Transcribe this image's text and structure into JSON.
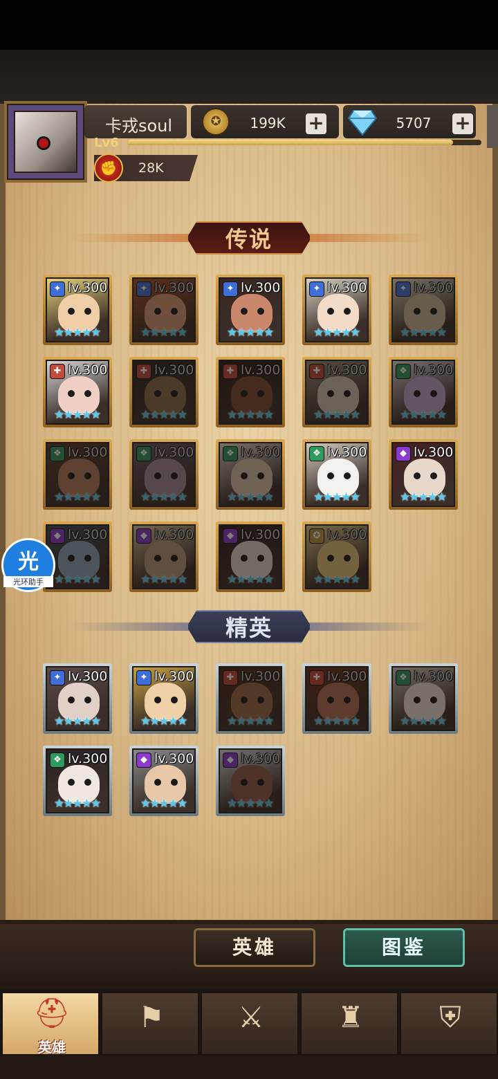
{
  "player": {
    "name": "卡戎soul",
    "level": "Lv6",
    "xp_fraction": 0.92,
    "coins": "199K",
    "gems": "5707",
    "power": "28K",
    "plus_symbol": "+"
  },
  "sections": {
    "legend_title": "传说",
    "elite_title": "精英"
  },
  "legend_heroes": [
    {
      "level": "lv.300",
      "stars": "★★★★★",
      "owned": true,
      "class": "blue",
      "skin": "#f0cfa8",
      "hair": "#e8d27a"
    },
    {
      "level": "lv.300",
      "stars": "★★★★★",
      "owned": false,
      "class": "blue",
      "skin": "#d49a7a",
      "hair": "#b2532c"
    },
    {
      "level": "lv.300",
      "stars": "★★★★★",
      "owned": true,
      "class": "blue",
      "skin": "#c9876b",
      "hair": "#3a2620"
    },
    {
      "level": "lv.300",
      "stars": "★★★★★",
      "owned": true,
      "class": "blue",
      "skin": "#f2dcc8",
      "hair": "#d8d0c0"
    },
    {
      "level": "lv.300",
      "stars": "★★★★★",
      "owned": false,
      "class": "blue",
      "skin": "#c7b59b",
      "hair": "#e7dfc7"
    },
    {
      "level": "lv.300",
      "stars": "★★★★★",
      "owned": true,
      "class": "red",
      "skin": "#f0d0c4",
      "hair": "#d6d6d6"
    },
    {
      "level": "lv.300",
      "stars": "★★★★★",
      "owned": false,
      "class": "red",
      "skin": "#8a6a4a",
      "hair": "#2a2420"
    },
    {
      "level": "lv.300",
      "stars": "★★★★★",
      "owned": false,
      "class": "red",
      "skin": "#7a4a34",
      "hair": "#2a1a14"
    },
    {
      "level": "lv.300",
      "stars": "★★★★★",
      "owned": false,
      "class": "red",
      "skin": "#cfc6b2",
      "hair": "#9a9080"
    },
    {
      "level": "lv.300",
      "stars": "★★★★★",
      "owned": false,
      "class": "green",
      "skin": "#b7a7c8",
      "hair": "#e1dde8"
    },
    {
      "level": "lv.300",
      "stars": "★★★★★",
      "owned": false,
      "class": "green",
      "skin": "#b07a5e",
      "hair": "#5a3a2a"
    },
    {
      "level": "lv.300",
      "stars": "★★★★★",
      "owned": false,
      "class": "green",
      "skin": "#a08a9a",
      "hair": "#6a5a6a"
    },
    {
      "level": "lv.300",
      "stars": "★★★★★",
      "owned": false,
      "class": "green",
      "skin": "#d8c2a8",
      "hair": "#e8e0d4"
    },
    {
      "level": "lv.300",
      "stars": "★★★★★",
      "owned": true,
      "class": "green",
      "skin": "#f4f2ee",
      "hair": "#d0c8bc"
    },
    {
      "level": "lv.300",
      "stars": "★★★★★",
      "owned": true,
      "class": "purple",
      "skin": "#e8d8cc",
      "hair": "#4a1e22"
    },
    {
      "level": "lv.300",
      "stars": "★★★★★",
      "owned": false,
      "class": "purple",
      "skin": "#8aa2b8",
      "hair": "#3a4a5a"
    },
    {
      "level": "lv.300",
      "stars": "★★★★★",
      "owned": false,
      "class": "purple",
      "skin": "#b29a82",
      "hair": "#d8c8a0"
    },
    {
      "level": "lv.300",
      "stars": "★★★★★",
      "owned": false,
      "class": "purple",
      "skin": "#e0d8d0",
      "hair": "#2a2020"
    },
    {
      "level": "lv.300",
      "stars": "★★★★★",
      "owned": false,
      "class": "gold",
      "skin": "#e2c27a",
      "hair": "#e8d28a"
    }
  ],
  "elite_heroes": [
    {
      "level": "lv.300",
      "stars": "★★★★★",
      "owned": true,
      "class": "blue",
      "skin": "#e0d0c8",
      "hair": "#5a4a48"
    },
    {
      "level": "lv.300",
      "stars": "★★★★★",
      "owned": true,
      "class": "blue",
      "skin": "#f0d0a8",
      "hair": "#c8a040"
    },
    {
      "level": "lv.300",
      "stars": "★★★★★",
      "owned": false,
      "class": "red",
      "skin": "#9a6a4a",
      "hair": "#4a2a1a"
    },
    {
      "level": "lv.300",
      "stars": "★★★★★",
      "owned": false,
      "class": "red",
      "skin": "#b07058",
      "hair": "#6a3020"
    },
    {
      "level": "lv.300",
      "stars": "★★★★★",
      "owned": false,
      "class": "green",
      "skin": "#eae2da",
      "hair": "#d8d0c8"
    },
    {
      "level": "lv.300",
      "stars": "★★★★★",
      "owned": true,
      "class": "green",
      "skin": "#f0e8e0",
      "hair": "#2a2424"
    },
    {
      "level": "lv.300",
      "stars": "★★★★★",
      "owned": true,
      "class": "purple",
      "skin": "#e8c8a8",
      "hair": "#8a8a8a"
    },
    {
      "level": "lv.300",
      "stars": "★★★★★",
      "owned": false,
      "class": "purple",
      "skin": "#8a5a4a",
      "hair": "#e0e0e0"
    }
  ],
  "assist": {
    "glyph": "光",
    "label": "光环助手"
  },
  "buttons": {
    "heroes": "英雄",
    "codex": "图鉴"
  },
  "nav": [
    {
      "label": "英雄",
      "icon": "helmet-icon",
      "glyph": "⛑",
      "active": true
    },
    {
      "label": "",
      "icon": "flag-icon",
      "glyph": "⚑",
      "active": false
    },
    {
      "label": "",
      "icon": "swords-icon",
      "glyph": "⚔",
      "active": false
    },
    {
      "label": "",
      "icon": "castle-icon",
      "glyph": "♜",
      "active": false
    },
    {
      "label": "",
      "icon": "shield-icon",
      "glyph": "⛨",
      "active": false
    }
  ],
  "colors": {
    "class_blue": "#3f6fd6",
    "class_red": "#c24a3a",
    "class_green": "#2d9a5e",
    "class_purple": "#8b3ad0",
    "class_gold": "#b89340"
  }
}
